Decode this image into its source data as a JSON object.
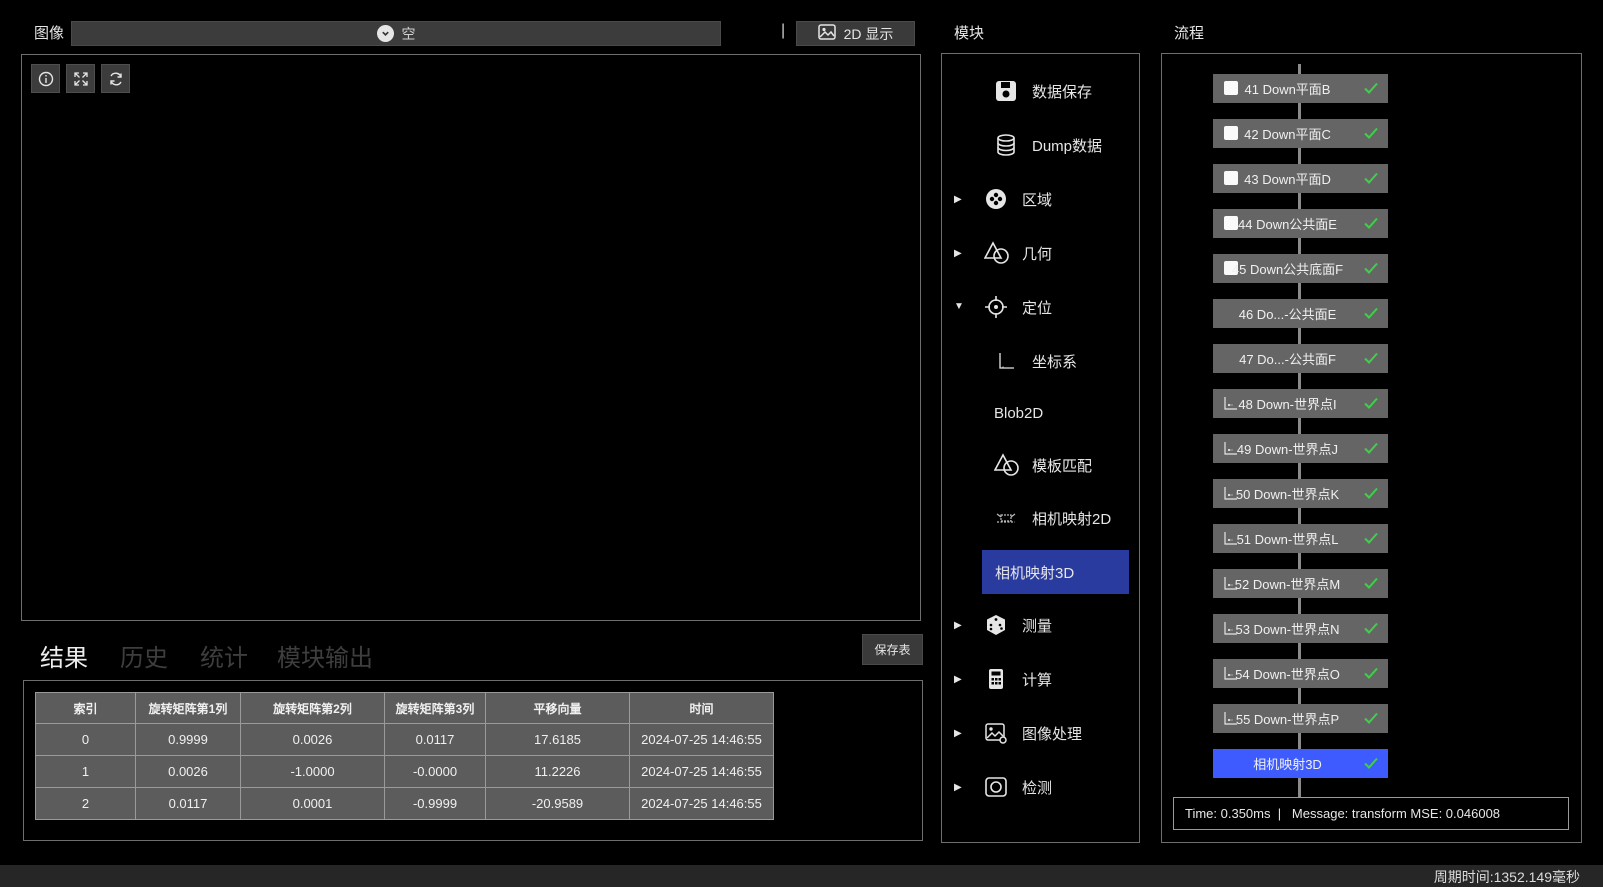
{
  "image_panel": {
    "label": "图像",
    "source_value": "空",
    "separator": "|",
    "display_button": "2D 显示"
  },
  "tabs": [
    "结果",
    "历史",
    "统计",
    "模块输出"
  ],
  "save_table_button": "保存表",
  "result_table": {
    "headers": [
      "索引",
      "旋转矩阵第1列",
      "旋转矩阵第2列",
      "旋转矩阵第3列",
      "平移向量",
      "时间"
    ],
    "rows": [
      [
        "0",
        "0.9999",
        "0.0026",
        "0.0117",
        "17.6185",
        "2024-07-25 14:46:55"
      ],
      [
        "1",
        "0.0026",
        "-1.0000",
        "-0.0000",
        "11.2226",
        "2024-07-25 14:46:55"
      ],
      [
        "2",
        "0.0117",
        "0.0001",
        "-0.9999",
        "-20.9589",
        "2024-07-25 14:46:55"
      ]
    ]
  },
  "modules": {
    "title": "模块",
    "items": [
      {
        "label": "数据保存",
        "icon": "save-icon"
      },
      {
        "label": "Dump数据",
        "icon": "database-icon"
      },
      {
        "label": "区域",
        "icon": "region-icon",
        "expander": "▶"
      },
      {
        "label": "几何",
        "icon": "geometry-icon",
        "expander": "▶"
      },
      {
        "label": "定位",
        "icon": "crosshair-icon",
        "expander": "▼"
      },
      {
        "label": "坐标系",
        "icon": "axes-icon"
      },
      {
        "label": "Blob2D"
      },
      {
        "label": "模板匹配",
        "icon": "template-icon"
      },
      {
        "label": "相机映射2D",
        "icon": "camera-map-icon"
      },
      {
        "label": "相机映射3D",
        "selected": true
      },
      {
        "label": "测量",
        "icon": "dice-icon",
        "expander": "▶"
      },
      {
        "label": "计算",
        "icon": "calculator-icon",
        "expander": "▶"
      },
      {
        "label": "图像处理",
        "icon": "image-process-icon",
        "expander": "▶"
      },
      {
        "label": "检测",
        "icon": "camera-icon",
        "expander": "▶"
      }
    ]
  },
  "flow": {
    "title": "流程",
    "nodes": [
      {
        "label": "41 Down平面B",
        "icon": "checkbox-icon"
      },
      {
        "label": "42 Down平面C",
        "icon": "checkbox-icon"
      },
      {
        "label": "43 Down平面D",
        "icon": "checkbox-icon"
      },
      {
        "label": "44 Down公共面E",
        "icon": "checkbox-icon"
      },
      {
        "label": "45 Down公共底面F",
        "icon": "checkbox-icon"
      },
      {
        "label": "46 Do...-公共面E"
      },
      {
        "label": "47 Do...-公共面F"
      },
      {
        "label": "48 Down-世界点I",
        "icon": "axes-icon"
      },
      {
        "label": "49 Down-世界点J",
        "icon": "axes-icon"
      },
      {
        "label": "50 Down-世界点K",
        "icon": "axes-icon"
      },
      {
        "label": "51 Down-世界点L",
        "icon": "axes-icon"
      },
      {
        "label": "52 Down-世界点M",
        "icon": "axes-icon"
      },
      {
        "label": "53 Down-世界点N",
        "icon": "axes-icon"
      },
      {
        "label": "54 Down-世界点O",
        "icon": "axes-icon"
      },
      {
        "label": "55 Down-世界点P",
        "icon": "axes-icon"
      },
      {
        "label": "相机映射3D",
        "selected": true
      }
    ],
    "message": "Time: 0.350ms  |   Message: transform MSE: 0.046008"
  },
  "status": {
    "cycle_time": "周期时间:1352.149毫秒"
  },
  "colors": {
    "selected_module": "#2a3ba0",
    "selected_node": "#3e5bff",
    "node_bg": "#656565",
    "check_green": "#3fd04a",
    "panel_border": "#6e6e6e"
  }
}
